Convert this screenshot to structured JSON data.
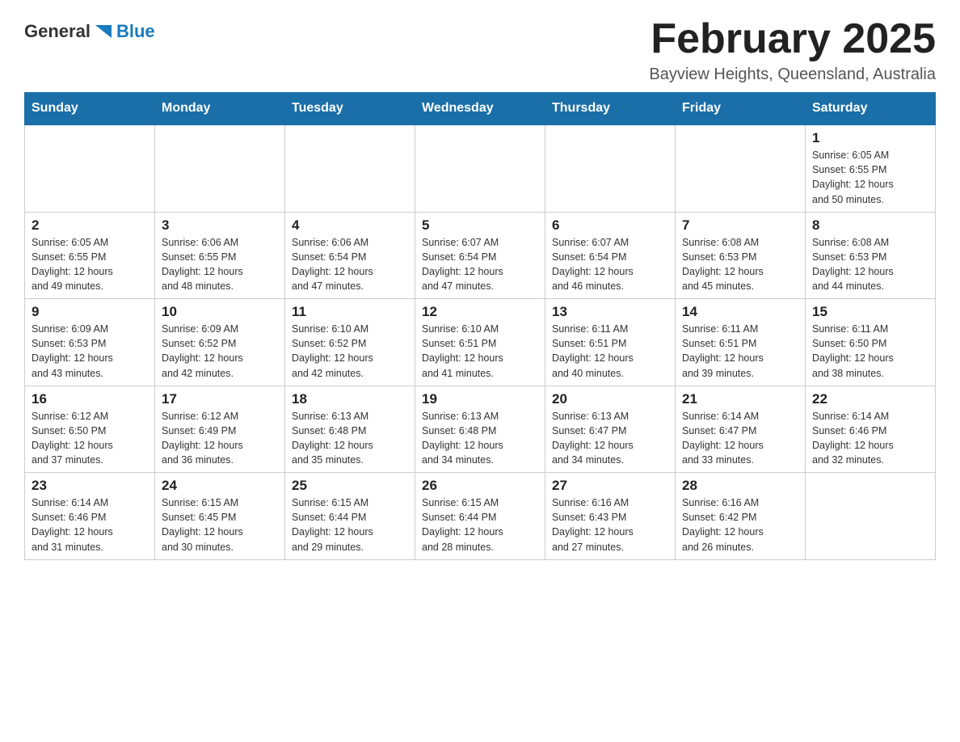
{
  "header": {
    "logo": {
      "general": "General",
      "blue": "Blue"
    },
    "title": "February 2025",
    "location": "Bayview Heights, Queensland, Australia"
  },
  "weekdays": [
    "Sunday",
    "Monday",
    "Tuesday",
    "Wednesday",
    "Thursday",
    "Friday",
    "Saturday"
  ],
  "weeks": [
    [
      {
        "day": "",
        "info": ""
      },
      {
        "day": "",
        "info": ""
      },
      {
        "day": "",
        "info": ""
      },
      {
        "day": "",
        "info": ""
      },
      {
        "day": "",
        "info": ""
      },
      {
        "day": "",
        "info": ""
      },
      {
        "day": "1",
        "info": "Sunrise: 6:05 AM\nSunset: 6:55 PM\nDaylight: 12 hours\nand 50 minutes."
      }
    ],
    [
      {
        "day": "2",
        "info": "Sunrise: 6:05 AM\nSunset: 6:55 PM\nDaylight: 12 hours\nand 49 minutes."
      },
      {
        "day": "3",
        "info": "Sunrise: 6:06 AM\nSunset: 6:55 PM\nDaylight: 12 hours\nand 48 minutes."
      },
      {
        "day": "4",
        "info": "Sunrise: 6:06 AM\nSunset: 6:54 PM\nDaylight: 12 hours\nand 47 minutes."
      },
      {
        "day": "5",
        "info": "Sunrise: 6:07 AM\nSunset: 6:54 PM\nDaylight: 12 hours\nand 47 minutes."
      },
      {
        "day": "6",
        "info": "Sunrise: 6:07 AM\nSunset: 6:54 PM\nDaylight: 12 hours\nand 46 minutes."
      },
      {
        "day": "7",
        "info": "Sunrise: 6:08 AM\nSunset: 6:53 PM\nDaylight: 12 hours\nand 45 minutes."
      },
      {
        "day": "8",
        "info": "Sunrise: 6:08 AM\nSunset: 6:53 PM\nDaylight: 12 hours\nand 44 minutes."
      }
    ],
    [
      {
        "day": "9",
        "info": "Sunrise: 6:09 AM\nSunset: 6:53 PM\nDaylight: 12 hours\nand 43 minutes."
      },
      {
        "day": "10",
        "info": "Sunrise: 6:09 AM\nSunset: 6:52 PM\nDaylight: 12 hours\nand 42 minutes."
      },
      {
        "day": "11",
        "info": "Sunrise: 6:10 AM\nSunset: 6:52 PM\nDaylight: 12 hours\nand 42 minutes."
      },
      {
        "day": "12",
        "info": "Sunrise: 6:10 AM\nSunset: 6:51 PM\nDaylight: 12 hours\nand 41 minutes."
      },
      {
        "day": "13",
        "info": "Sunrise: 6:11 AM\nSunset: 6:51 PM\nDaylight: 12 hours\nand 40 minutes."
      },
      {
        "day": "14",
        "info": "Sunrise: 6:11 AM\nSunset: 6:51 PM\nDaylight: 12 hours\nand 39 minutes."
      },
      {
        "day": "15",
        "info": "Sunrise: 6:11 AM\nSunset: 6:50 PM\nDaylight: 12 hours\nand 38 minutes."
      }
    ],
    [
      {
        "day": "16",
        "info": "Sunrise: 6:12 AM\nSunset: 6:50 PM\nDaylight: 12 hours\nand 37 minutes."
      },
      {
        "day": "17",
        "info": "Sunrise: 6:12 AM\nSunset: 6:49 PM\nDaylight: 12 hours\nand 36 minutes."
      },
      {
        "day": "18",
        "info": "Sunrise: 6:13 AM\nSunset: 6:48 PM\nDaylight: 12 hours\nand 35 minutes."
      },
      {
        "day": "19",
        "info": "Sunrise: 6:13 AM\nSunset: 6:48 PM\nDaylight: 12 hours\nand 34 minutes."
      },
      {
        "day": "20",
        "info": "Sunrise: 6:13 AM\nSunset: 6:47 PM\nDaylight: 12 hours\nand 34 minutes."
      },
      {
        "day": "21",
        "info": "Sunrise: 6:14 AM\nSunset: 6:47 PM\nDaylight: 12 hours\nand 33 minutes."
      },
      {
        "day": "22",
        "info": "Sunrise: 6:14 AM\nSunset: 6:46 PM\nDaylight: 12 hours\nand 32 minutes."
      }
    ],
    [
      {
        "day": "23",
        "info": "Sunrise: 6:14 AM\nSunset: 6:46 PM\nDaylight: 12 hours\nand 31 minutes."
      },
      {
        "day": "24",
        "info": "Sunrise: 6:15 AM\nSunset: 6:45 PM\nDaylight: 12 hours\nand 30 minutes."
      },
      {
        "day": "25",
        "info": "Sunrise: 6:15 AM\nSunset: 6:44 PM\nDaylight: 12 hours\nand 29 minutes."
      },
      {
        "day": "26",
        "info": "Sunrise: 6:15 AM\nSunset: 6:44 PM\nDaylight: 12 hours\nand 28 minutes."
      },
      {
        "day": "27",
        "info": "Sunrise: 6:16 AM\nSunset: 6:43 PM\nDaylight: 12 hours\nand 27 minutes."
      },
      {
        "day": "28",
        "info": "Sunrise: 6:16 AM\nSunset: 6:42 PM\nDaylight: 12 hours\nand 26 minutes."
      },
      {
        "day": "",
        "info": ""
      }
    ]
  ]
}
